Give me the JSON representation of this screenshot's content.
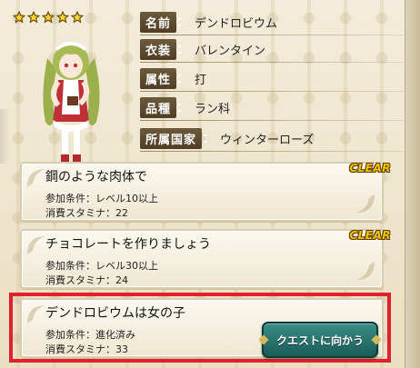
{
  "rarity": {
    "stars": 5
  },
  "profile": {
    "rows": [
      {
        "label": "名前",
        "value": "デンドロビウム"
      },
      {
        "label": "衣装",
        "value": "バレンタイン"
      },
      {
        "label": "属性",
        "value": "打"
      },
      {
        "label": "品種",
        "value": "ラン科"
      },
      {
        "label": "所属国家",
        "value": "ウィンターローズ"
      }
    ]
  },
  "quests": [
    {
      "title": "鋼のような肉体で",
      "condition": "参加条件：レベル10以上",
      "stamina": "消費スタミナ：22",
      "badge": "CLEAR"
    },
    {
      "title": "チョコレートを作りましょう",
      "condition": "参加条件：レベル30以上",
      "stamina": "消費スタミナ：24",
      "badge": "CLEAR"
    },
    {
      "title": "デンドロビウムは女の子",
      "condition": "参加条件：進化済み",
      "stamina": "消費スタミナ：33",
      "button": "クエストに向かう"
    }
  ],
  "colors": {
    "highlight": "#e0202a",
    "button": "#2a7672",
    "badge": "#f2c300"
  }
}
